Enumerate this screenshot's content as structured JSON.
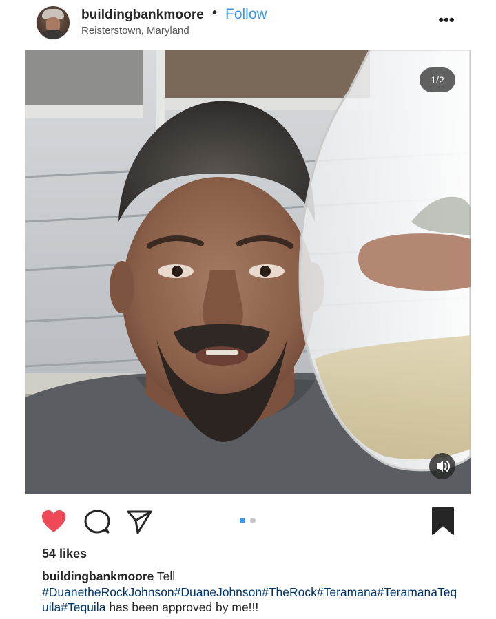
{
  "post": {
    "username": "buildingbankmoore",
    "separator": "•",
    "follow_label": "Follow",
    "location": "Reisterstown, Maryland",
    "more_label": "•••",
    "media": {
      "counter": "1/2",
      "slide_count": 2,
      "active_slide": 1
    },
    "likes": "54 likes",
    "caption": {
      "username": "buildingbankmoore",
      "lead_text": "Tell",
      "hashtags": "#DuanetheRockJohnson#DuaneJohnson#TheRock#Teramana#TeramanaTequila#Tequila",
      "trail_text": "has been approved by me!!!"
    }
  },
  "icons": {
    "like": "heart-filled-icon",
    "comment": "comment-bubble-icon",
    "share": "paper-plane-icon",
    "save": "bookmark-filled-icon",
    "sound": "speaker-icon"
  },
  "colors": {
    "like": "#ed4956",
    "link": "#3897f0",
    "hashtag": "#003569",
    "text": "#262626",
    "indicator_active": "#3897f0",
    "indicator_inactive": "#c7c7c7"
  }
}
